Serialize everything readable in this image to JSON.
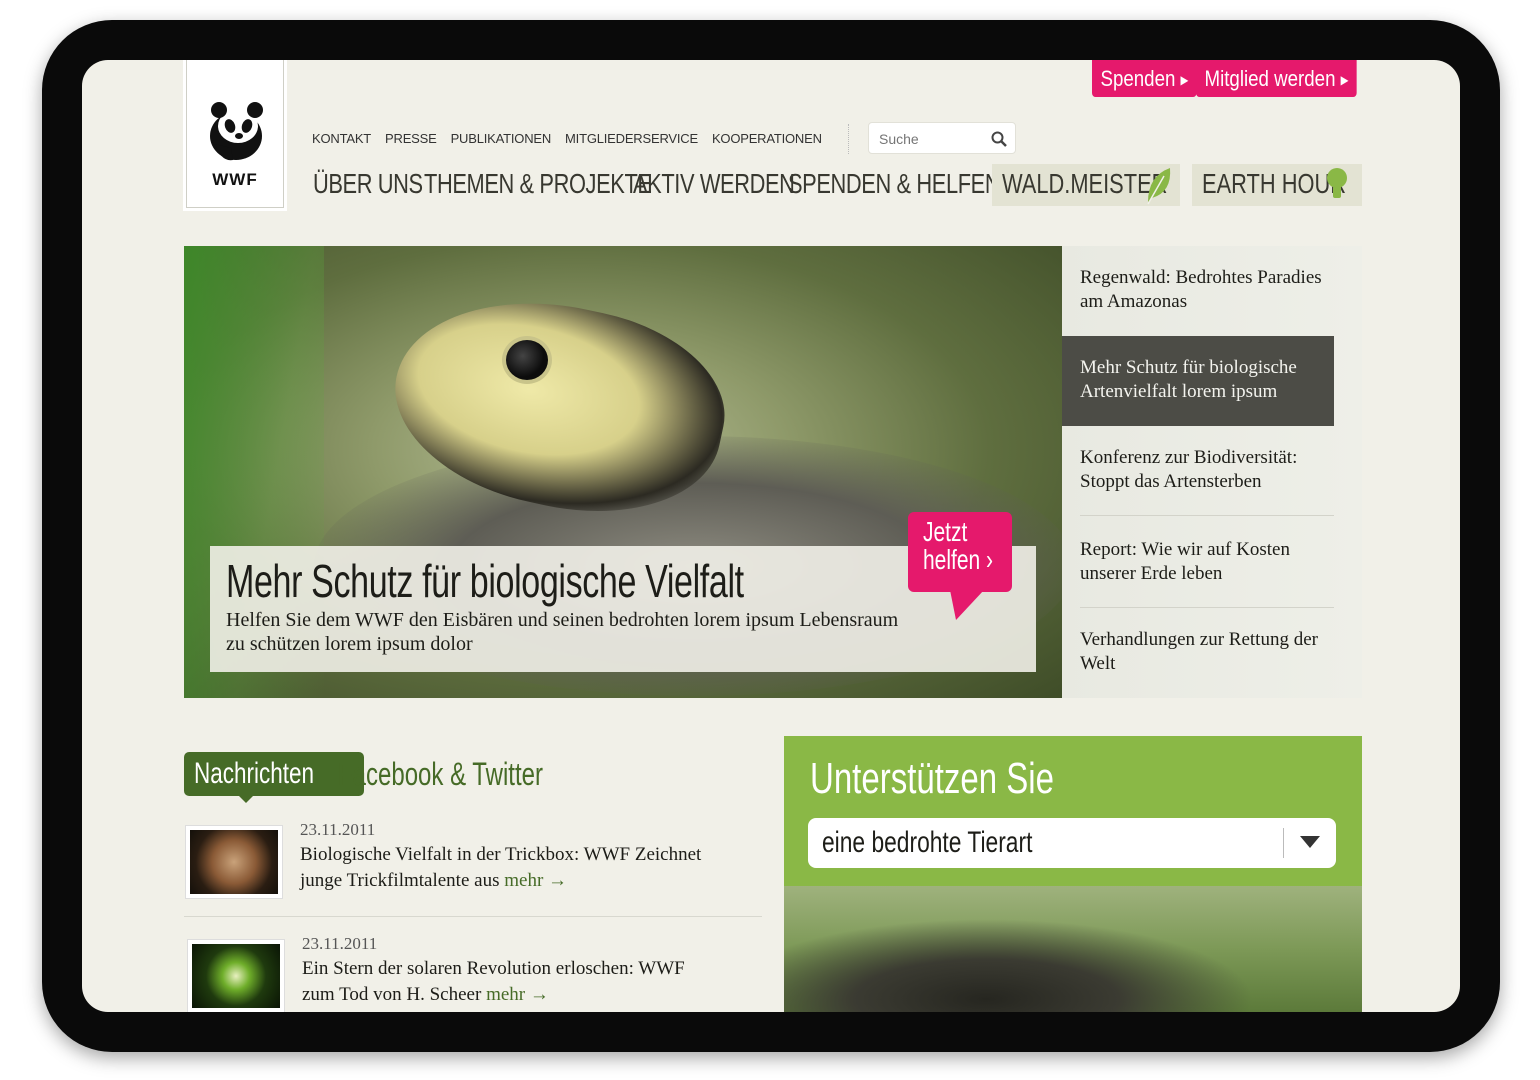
{
  "logo": {
    "text": "WWF"
  },
  "top_buttons": {
    "donate": "Spenden",
    "member": "Mitglied werden"
  },
  "small_nav": [
    "KONTAKT",
    "PRESSE",
    "PUBLIKATIONEN",
    "MITGLIEDERSERVICE",
    "KOOPERATIONEN"
  ],
  "search": {
    "placeholder": "Suche"
  },
  "main_nav": [
    "ÜBER UNS",
    "THEMEN & PROJEKTE",
    "AKTIV WERDEN",
    "SPENDEN & HELFEN"
  ],
  "special_nav": {
    "wald": "WALD.MEISTER",
    "earth": "EARTH HOUR"
  },
  "hero": {
    "title": "Mehr Schutz für biologische Vielfalt",
    "subtitle": "Helfen Sie dem WWF den Eisbären und seinen bedrohten lorem ipsum Lebensraum zu schützen lorem ipsum dolor",
    "cta": "Jetzt helfen ›"
  },
  "teasers": [
    "Regenwald: Bedrohtes Paradies am Amazonas",
    "Mehr Schutz für biologische Artenvielfalt lorem ipsum",
    "Konferenz zur Biodiversität: Stoppt das Artensterben",
    "Report: Wie wir auf Kosten unserer Erde leben",
    "Verhandlungen zur Rettung der Welt"
  ],
  "news_tabs": {
    "active": "Nachrichten",
    "other": "Facebook & Twitter"
  },
  "news": [
    {
      "date": "23.11.2011",
      "text": "Biologische Vielfalt in der Trickbox: WWF Zeichnet junge Trickfilmtalente aus",
      "more": "mehr →"
    },
    {
      "date": "23.11.2011",
      "text": "Ein Stern der solaren Revolution erloschen: WWF zum Tod von H. Scheer",
      "more": "mehr →"
    }
  ],
  "support": {
    "title": "Unterstützen Sie",
    "selected": "eine bedrohte Tierart"
  },
  "colors": {
    "pink": "#e5196c",
    "green_dark": "#466b27",
    "green_light": "#8ab846",
    "bg": "#f1f0e8"
  }
}
